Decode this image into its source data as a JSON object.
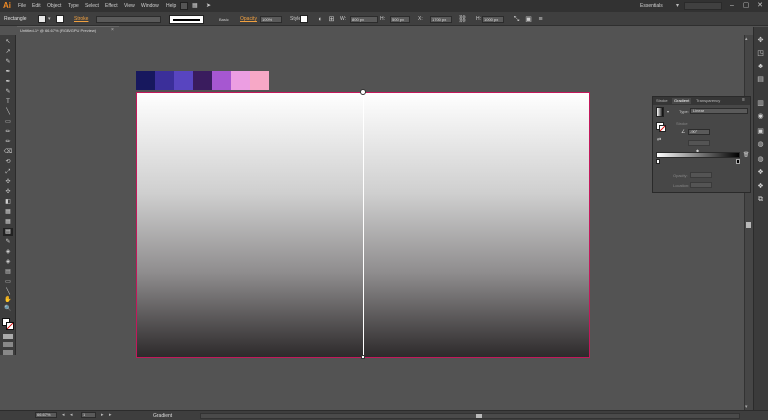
{
  "app": {
    "logo": "Ai",
    "workspace": "Essentials",
    "workspace_chevron": "▾",
    "window_buttons": [
      "–",
      "▢",
      "✕"
    ]
  },
  "menu": [
    "File",
    "Edit",
    "Object",
    "Type",
    "Select",
    "Effect",
    "View",
    "Window",
    "Help"
  ],
  "control_bar": {
    "selection_label": "Rectangle",
    "stroke_label": "Stroke",
    "profile_label": "Basic",
    "opacity_label": "Opacity",
    "opacity_value": "100%",
    "style_label": "Style",
    "w_label": "W:",
    "w_value": "800 px",
    "h_label": "H:",
    "y_value": "500 px",
    "x_label": "X:",
    "x_value": "1700 px",
    "h2_label": "H:",
    "h2_value": "1000 px"
  },
  "document": {
    "tab_title": "Untitled-1* @ 66.67% (RGB/GPU Preview)",
    "close_glyph": "×"
  },
  "toolbar": {
    "tools": [
      "↖",
      "↗",
      "✎",
      "✒",
      "T",
      "╲",
      "▭",
      "✏",
      "⌫",
      "⟲",
      "⤢",
      "✣",
      "◧",
      "▦",
      "▤",
      "◈",
      "✋",
      "🔍"
    ]
  },
  "canvas": {
    "swatch_colors": [
      "#17185e",
      "#3b2f9a",
      "#5845c0",
      "#3a1c5e",
      "#a657d1",
      "#ec9ee2",
      "#f7a8c6"
    ],
    "gradient": {
      "start_color": "#ffffff",
      "end_color": "#2d2a2b"
    }
  },
  "gradient_panel": {
    "tabs": [
      "Stroke",
      "Gradient",
      "Transparency"
    ],
    "menu_glyph": "≡",
    "type_label": "Type:",
    "type_value": "Linear",
    "stroke_label": "Stroke",
    "angle_icon": "∠",
    "angle_value": "-90°",
    "reverse_icon": "⇄",
    "midpoint_glyph": "◆",
    "opacity_label": "Opacity:",
    "location_label": "Location:"
  },
  "status_bar": {
    "zoom_value": "66.67%",
    "page_value": "1",
    "tool_name": "Gradient",
    "nav_first": "◂",
    "nav_last": "▸"
  },
  "dock": {
    "icons": [
      "✥",
      "◳",
      "♣",
      "▤",
      "▥",
      "◉",
      "▣",
      "◍",
      "❖",
      "⧉"
    ]
  },
  "scroll": {
    "up": "▴",
    "down": "▾"
  }
}
